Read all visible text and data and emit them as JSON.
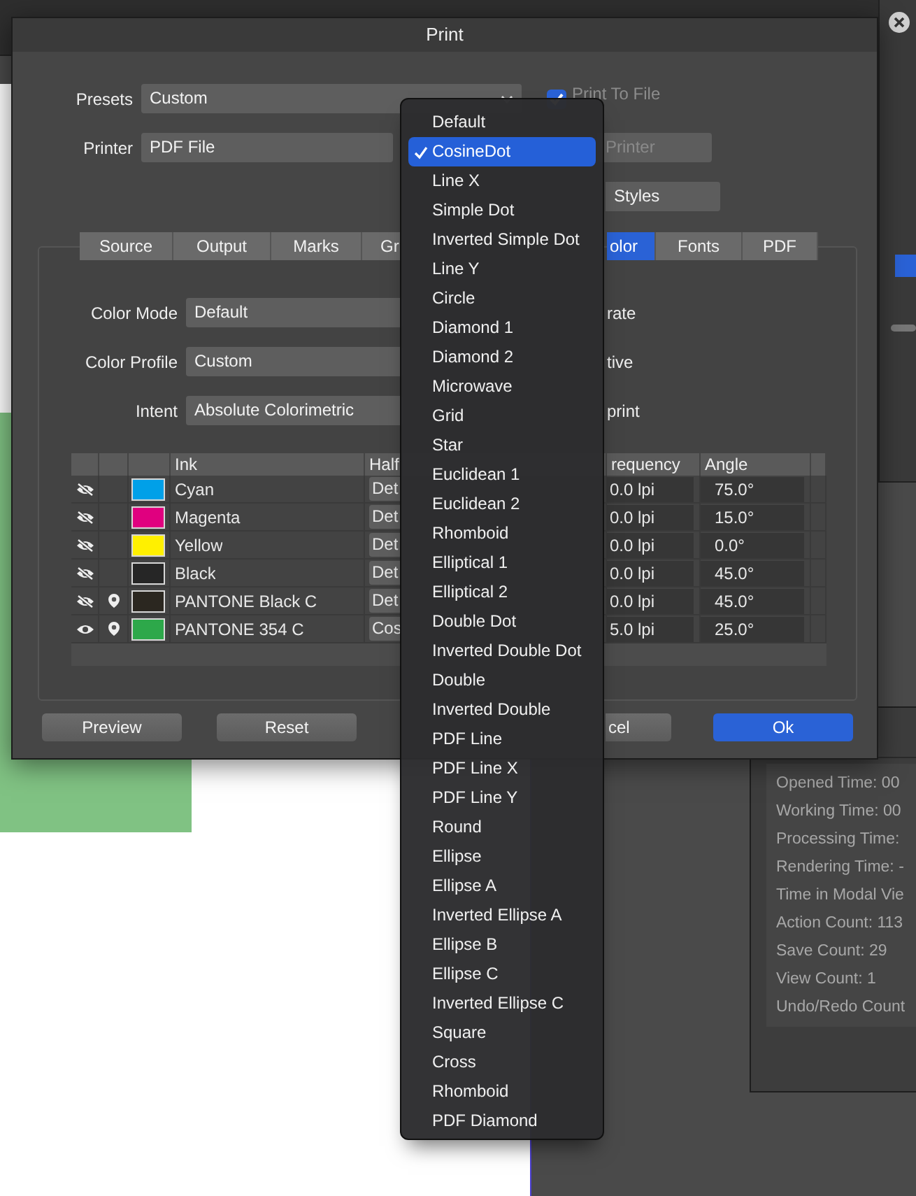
{
  "dialog": {
    "title": "Print",
    "presets": {
      "label": "Presets",
      "value": "Custom"
    },
    "print_to_file": {
      "label": "Print To File",
      "checked": true
    },
    "printer": {
      "label": "Printer",
      "value": "PDF File"
    },
    "side_buttons": [
      {
        "label": "Printer",
        "disabled": true
      },
      {
        "label": "Styles",
        "disabled": false
      }
    ],
    "tabs": [
      {
        "label": "Source",
        "selected": false
      },
      {
        "label": "Output",
        "selected": false
      },
      {
        "label": "Marks",
        "selected": false
      },
      {
        "label": "Gr",
        "selected": false
      },
      {
        "label": "olor",
        "selected": true
      },
      {
        "label": "Fonts",
        "selected": false
      },
      {
        "label": "PDF",
        "selected": false
      }
    ],
    "color_fields": [
      {
        "label": "Color Mode",
        "value": "Default",
        "side_text": "rate"
      },
      {
        "label": "Color Profile",
        "value": "Custom",
        "side_text": "tive"
      },
      {
        "label": "Intent",
        "value": "Absolute Colorimetric",
        "side_text": "print"
      }
    ],
    "ink_table": {
      "columns": [
        "Ink",
        "Half",
        "requency",
        "Angle"
      ],
      "rows": [
        {
          "visible": false,
          "spot": false,
          "color": "#00a0e8",
          "ink": "Cyan",
          "halftone": "Det",
          "frequency": "0.0 lpi",
          "angle": "75.0°"
        },
        {
          "visible": false,
          "spot": false,
          "color": "#e0007f",
          "ink": "Magenta",
          "halftone": "Det",
          "frequency": "0.0 lpi",
          "angle": "15.0°"
        },
        {
          "visible": false,
          "spot": false,
          "color": "#fff000",
          "ink": "Yellow",
          "halftone": "Det",
          "frequency": "0.0 lpi",
          "angle": "0.0°"
        },
        {
          "visible": false,
          "spot": false,
          "color": "#262626",
          "ink": "Black",
          "halftone": "Det",
          "frequency": "0.0 lpi",
          "angle": "45.0°"
        },
        {
          "visible": false,
          "spot": true,
          "color": "#2b2720",
          "ink": "PANTONE Black C",
          "halftone": "Det",
          "frequency": "0.0 lpi",
          "angle": "45.0°"
        },
        {
          "visible": true,
          "spot": true,
          "color": "#2da84a",
          "ink": "PANTONE 354 C",
          "halftone": "Cos",
          "frequency": "5.0 lpi",
          "angle": "25.0°"
        }
      ]
    },
    "buttons": [
      {
        "label": "Preview",
        "kind": "normal"
      },
      {
        "label": "Reset",
        "kind": "normal"
      },
      {
        "label": "cel",
        "kind": "normal"
      },
      {
        "label": "Ok",
        "kind": "primary"
      }
    ]
  },
  "menu": {
    "items": [
      {
        "label": "Default",
        "selected": false
      },
      {
        "label": "CosineDot",
        "selected": true
      },
      {
        "label": "Line X",
        "selected": false
      },
      {
        "label": "Simple Dot",
        "selected": false
      },
      {
        "label": "Inverted Simple Dot",
        "selected": false
      },
      {
        "label": "Line Y",
        "selected": false
      },
      {
        "label": "Circle",
        "selected": false
      },
      {
        "label": "Diamond 1",
        "selected": false
      },
      {
        "label": "Diamond 2",
        "selected": false
      },
      {
        "label": "Microwave",
        "selected": false
      },
      {
        "label": "Grid",
        "selected": false
      },
      {
        "label": "Star",
        "selected": false
      },
      {
        "label": "Euclidean 1",
        "selected": false
      },
      {
        "label": "Euclidean 2",
        "selected": false
      },
      {
        "label": "Rhomboid",
        "selected": false
      },
      {
        "label": "Elliptical 1",
        "selected": false
      },
      {
        "label": "Elliptical 2",
        "selected": false
      },
      {
        "label": "Double Dot",
        "selected": false
      },
      {
        "label": "Inverted Double Dot",
        "selected": false
      },
      {
        "label": "Double",
        "selected": false
      },
      {
        "label": "Inverted Double",
        "selected": false
      },
      {
        "label": "PDF Line",
        "selected": false
      },
      {
        "label": "PDF Line X",
        "selected": false
      },
      {
        "label": "PDF Line Y",
        "selected": false
      },
      {
        "label": "Round",
        "selected": false
      },
      {
        "label": "Ellipse",
        "selected": false
      },
      {
        "label": "Ellipse A",
        "selected": false
      },
      {
        "label": "Inverted Ellipse A",
        "selected": false
      },
      {
        "label": "Ellipse B",
        "selected": false
      },
      {
        "label": "Ellipse C",
        "selected": false
      },
      {
        "label": "Inverted Ellipse C",
        "selected": false
      },
      {
        "label": "Square",
        "selected": false
      },
      {
        "label": "Cross",
        "selected": false
      },
      {
        "label": "Rhomboid",
        "selected": false
      },
      {
        "label": "PDF Diamond",
        "selected": false
      }
    ]
  },
  "stats": [
    "Opened Time: 00",
    "Working Time: 00",
    "Processing Time:",
    "Rendering Time: -",
    "Time in Modal Vie",
    "Action Count: 113",
    "Save Count: 29",
    "View Count: 1",
    "Undo/Redo Count"
  ]
}
